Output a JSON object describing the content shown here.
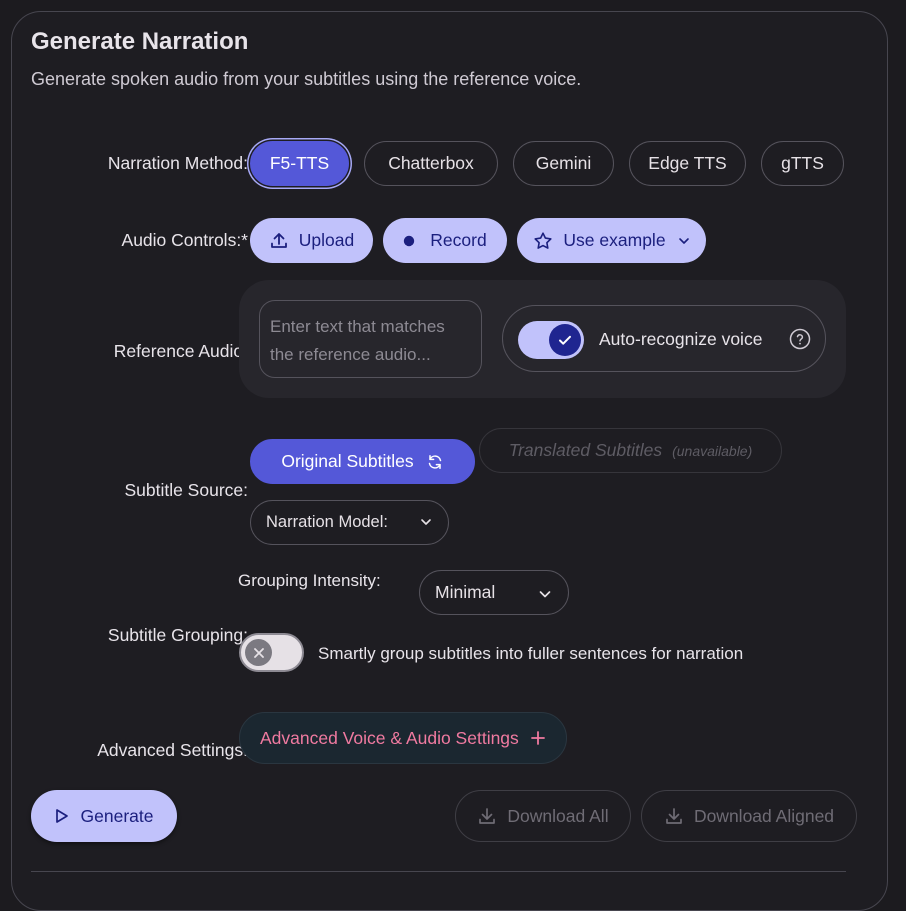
{
  "header": {
    "title": "Generate Narration",
    "subtitle": "Generate spoken audio from your subtitles using the reference voice."
  },
  "narration_method": {
    "label": "Narration Method:",
    "options": [
      "F5-TTS",
      "Chatterbox",
      "Gemini",
      "Edge TTS",
      "gTTS"
    ],
    "selected": "F5-TTS"
  },
  "audio_controls": {
    "label": "Audio Controls:*",
    "upload": "Upload",
    "record": "Record",
    "use_example": "Use example"
  },
  "reference_audio": {
    "label": "Reference Audio:",
    "placeholder": "Enter text that matches the reference audio...",
    "auto_recognize": "Auto-recognize voice",
    "auto_recognize_on": true
  },
  "subtitle_source": {
    "label": "Subtitle Source:",
    "original": "Original Subtitles",
    "translated": "Translated Subtitles",
    "translated_note": "(unavailable)",
    "model_label": "Narration Model:"
  },
  "subtitle_grouping": {
    "label": "Subtitle Grouping:",
    "intensity_label": "Grouping Intensity:",
    "intensity_value": "Minimal",
    "smart_group_text": "Smartly group subtitles into fuller sentences for narration",
    "smart_group_on": false
  },
  "advanced": {
    "label": "Advanced Settings:",
    "button": "Advanced Voice & Audio Settings"
  },
  "actions": {
    "generate": "Generate",
    "download_all": "Download All",
    "download_aligned": "Download Aligned"
  },
  "colors": {
    "selected": "#5458d8",
    "tonal": "#c1c2fb",
    "accent_pink": "#f07aa0"
  }
}
